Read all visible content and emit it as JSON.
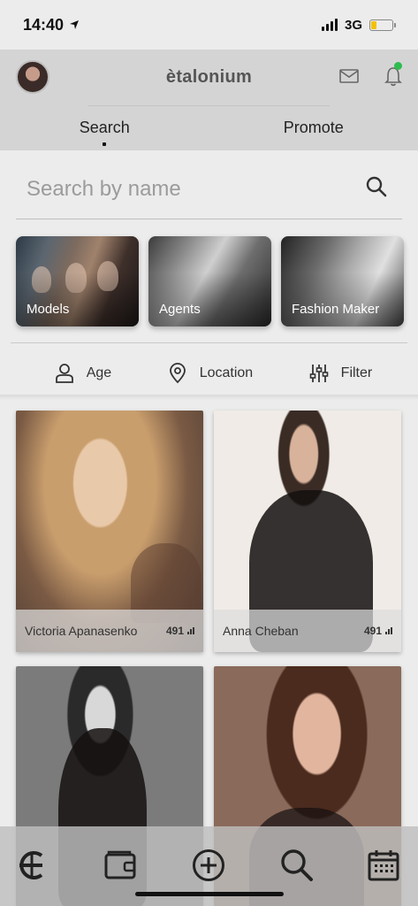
{
  "status_bar": {
    "time": "14:40",
    "network": "3G",
    "battery_level": 0.25,
    "battery_color": "#f2c200"
  },
  "header": {
    "brand": "ètalonium",
    "tabs": [
      {
        "label": "Search",
        "active": true
      },
      {
        "label": "Promote",
        "active": false
      }
    ],
    "notification_dot_color": "#2dbd4e"
  },
  "search": {
    "placeholder": "Search by name",
    "value": ""
  },
  "categories": [
    {
      "label": "Models"
    },
    {
      "label": "Agents"
    },
    {
      "label": "Fashion Maker"
    }
  ],
  "filters": [
    {
      "label": "Age",
      "icon": "person-icon"
    },
    {
      "label": "Location",
      "icon": "location-pin-icon"
    },
    {
      "label": "Filter",
      "icon": "sliders-icon"
    }
  ],
  "profiles": [
    {
      "name": "Victoria Apanasenko",
      "count": "491"
    },
    {
      "name": "Anna Cheban",
      "count": "491"
    },
    {
      "name": "",
      "count": ""
    },
    {
      "name": "",
      "count": ""
    }
  ],
  "bottom_nav": [
    {
      "icon": "etalonium-logo-icon"
    },
    {
      "icon": "wallet-icon"
    },
    {
      "icon": "add-circle-icon"
    },
    {
      "icon": "search-icon"
    },
    {
      "icon": "calendar-icon"
    }
  ]
}
